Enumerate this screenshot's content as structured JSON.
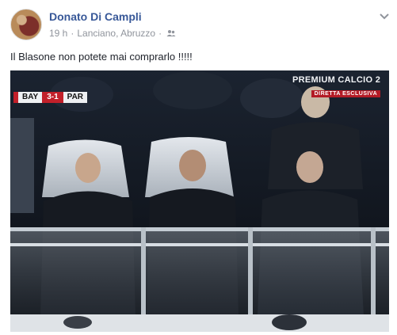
{
  "post": {
    "author": "Donato Di Campli",
    "time": "19 h",
    "location": "Lanciano, Abruzzo",
    "separator": "·",
    "text": "Il Blasone non potete mai comprarlo !!!!!",
    "audience_icon": "friends-icon",
    "menu_icon": "chevron-down-icon"
  },
  "photo": {
    "scorebug": {
      "home": "BAY",
      "score": "3-1",
      "away": "PAR"
    },
    "broadcaster": {
      "brand": "PREMIUM CALCIO 2",
      "sub": "DIRETTA ESCLUSIVA"
    }
  },
  "colors": {
    "author": "#385898",
    "meta": "#90949c",
    "text": "#1d2129",
    "score_red": "#c2202a"
  }
}
